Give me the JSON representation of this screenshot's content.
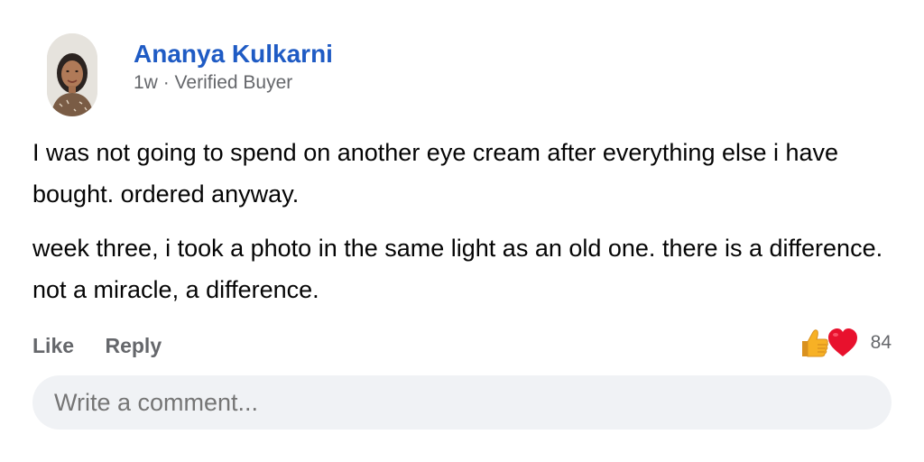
{
  "author": {
    "name": "Ananya Kulkarni",
    "time": "1w",
    "separator": "·",
    "badge": "Verified Buyer"
  },
  "post": {
    "paragraphs": [
      "I was not going to spend on another eye cream after everything else i have bought. ordered anyway.",
      "week three, i took a photo in the same light as an old one. there is a difference. not a miracle, a difference."
    ]
  },
  "actions": {
    "like_label": "Like",
    "reply_label": "Reply"
  },
  "reactions": {
    "icons": [
      "thumbs-up-icon",
      "heart-icon"
    ],
    "count": "84"
  },
  "comment": {
    "placeholder": "Write a comment..."
  },
  "colors": {
    "author_name": "#1f5bc4",
    "muted_text": "#65676b",
    "comment_bg": "#f0f2f5",
    "heart": "#e8112d",
    "thumb": "#f7b125"
  }
}
